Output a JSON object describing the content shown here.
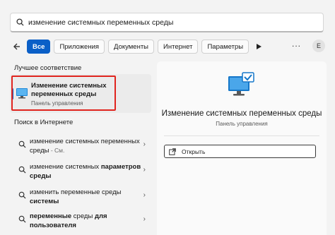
{
  "search": {
    "query": "изменение системных переменных среды"
  },
  "filters": {
    "tabs": [
      "Все",
      "Приложения",
      "Документы",
      "Интернет",
      "Параметры"
    ],
    "more": "...",
    "avatar_letter": "E"
  },
  "best_match": {
    "header": "Лучшее соответствие",
    "title": "Изменение системных переменных среды",
    "subtitle": "Панель управления"
  },
  "web": {
    "header": "Поиск в Интернете",
    "items": [
      {
        "plain": "изменение системных переменных среды",
        "suffix": " - См."
      },
      {
        "plain": "изменение системных ",
        "bold": "параметров среды"
      },
      {
        "plain": "изменить переменные среды ",
        "bold": "системы"
      },
      {
        "bold1": "переменные",
        "plain": " среды ",
        "bold": "для пользователя"
      }
    ]
  },
  "detail": {
    "title": "Изменение системных переменных среды",
    "subtitle": "Панель управления",
    "open_label": "Открыть"
  },
  "colors": {
    "accent": "#0a5fc7",
    "highlight": "#e0241e"
  }
}
